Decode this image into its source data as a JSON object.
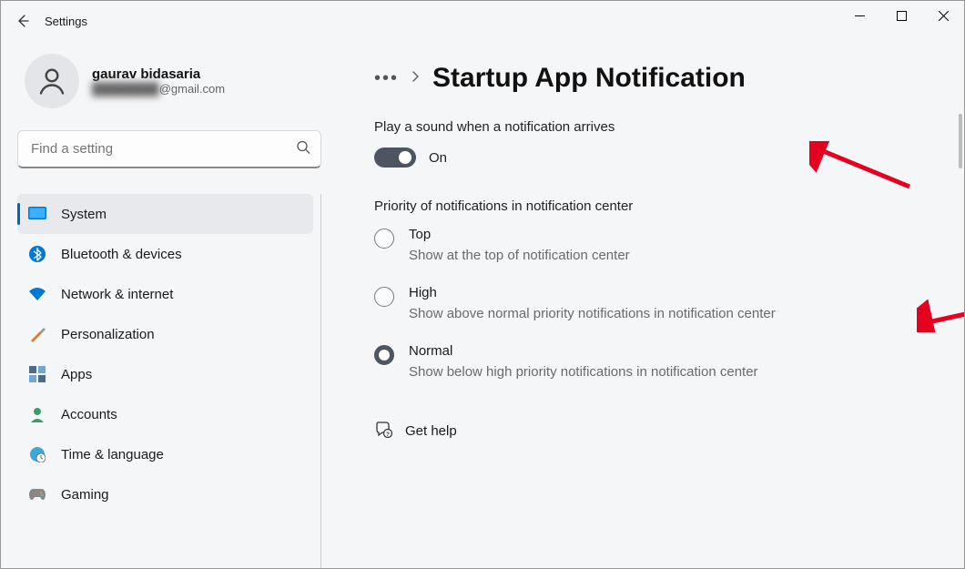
{
  "window": {
    "title": "Settings"
  },
  "user": {
    "name": "gaurav bidasaria",
    "email_prefix": "████████",
    "email_suffix": "@gmail.com"
  },
  "search": {
    "placeholder": "Find a setting"
  },
  "sidebar": {
    "items": [
      {
        "label": "System",
        "selected": true
      },
      {
        "label": "Bluetooth & devices"
      },
      {
        "label": "Network & internet"
      },
      {
        "label": "Personalization"
      },
      {
        "label": "Apps"
      },
      {
        "label": "Accounts"
      },
      {
        "label": "Time & language"
      },
      {
        "label": "Gaming"
      }
    ]
  },
  "page": {
    "title": "Startup App Notification",
    "sound_section": {
      "label": "Play a sound when a notification arrives",
      "toggle_state": "On"
    },
    "priority_section": {
      "label": "Priority of notifications in notification center",
      "options": [
        {
          "label": "Top",
          "desc": "Show at the top of notification center",
          "checked": false
        },
        {
          "label": "High",
          "desc": "Show above normal priority notifications in notification center",
          "checked": false
        },
        {
          "label": "Normal",
          "desc": "Show below high priority notifications in notification center",
          "checked": true
        }
      ]
    },
    "help": "Get help"
  }
}
